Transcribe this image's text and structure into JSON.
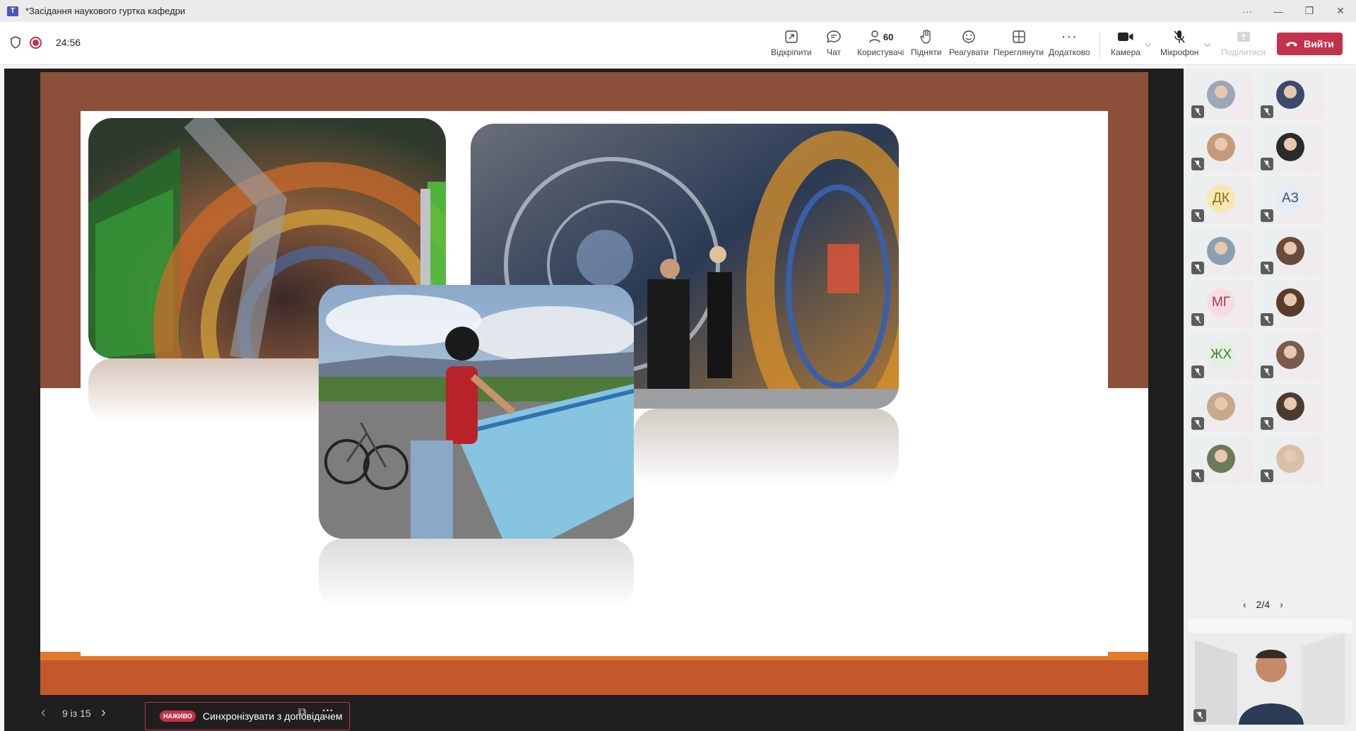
{
  "window": {
    "title": "*Засідання наукового гуртка кафедри",
    "app_logo": "T",
    "controls": [
      "more-icon",
      "minimize-icon",
      "restore-icon",
      "close-icon"
    ]
  },
  "meeting": {
    "timer": "24:56",
    "toolbar": {
      "unpin": "Відкріпити",
      "chat": "Чат",
      "users": "Користувачі",
      "users_count": "60",
      "raise": "Підняти",
      "react": "Реагувати",
      "view": "Переглянути",
      "more": "Додатково",
      "camera": "Камера",
      "mic": "Мікрофон",
      "share": "Поділитися",
      "leave": "Вийти"
    },
    "colors": {
      "leave": "#c4314b",
      "slide_band": "#8b4f3a",
      "slide_bottom": "#c4572b"
    }
  },
  "slide_nav": {
    "page": "9 із 15",
    "live_badge": "НАЖИВО",
    "sync_label": "Синхронізувати з доповідачем"
  },
  "participants": {
    "tiles": [
      {
        "initials": "",
        "icon": "avatar-photo"
      },
      {
        "initials": "",
        "icon": "avatar-photo"
      },
      {
        "initials": "",
        "icon": "avatar-photo"
      },
      {
        "initials": "",
        "icon": "avatar-photo"
      },
      {
        "initials": "ДК",
        "color": "#f7e7b0",
        "text": "#8a6d1c"
      },
      {
        "initials": "АЗ",
        "color": "#e5ecf5",
        "text": "#3b5576"
      },
      {
        "initials": "",
        "icon": "avatar-photo"
      },
      {
        "initials": "",
        "icon": "avatar-photo"
      },
      {
        "initials": "МГ",
        "color": "#f6dde3",
        "text": "#a43b55"
      },
      {
        "initials": "",
        "icon": "avatar-photo"
      },
      {
        "initials": "ЖХ",
        "color": "#e2f0df",
        "text": "#3f7a35"
      },
      {
        "initials": "",
        "icon": "avatar-photo"
      },
      {
        "initials": "",
        "icon": "avatar-photo"
      },
      {
        "initials": "",
        "icon": "avatar-photo"
      },
      {
        "initials": "",
        "icon": "avatar-photo"
      },
      {
        "initials": "",
        "icon": "avatar-photo"
      }
    ],
    "pager": "2/4"
  }
}
